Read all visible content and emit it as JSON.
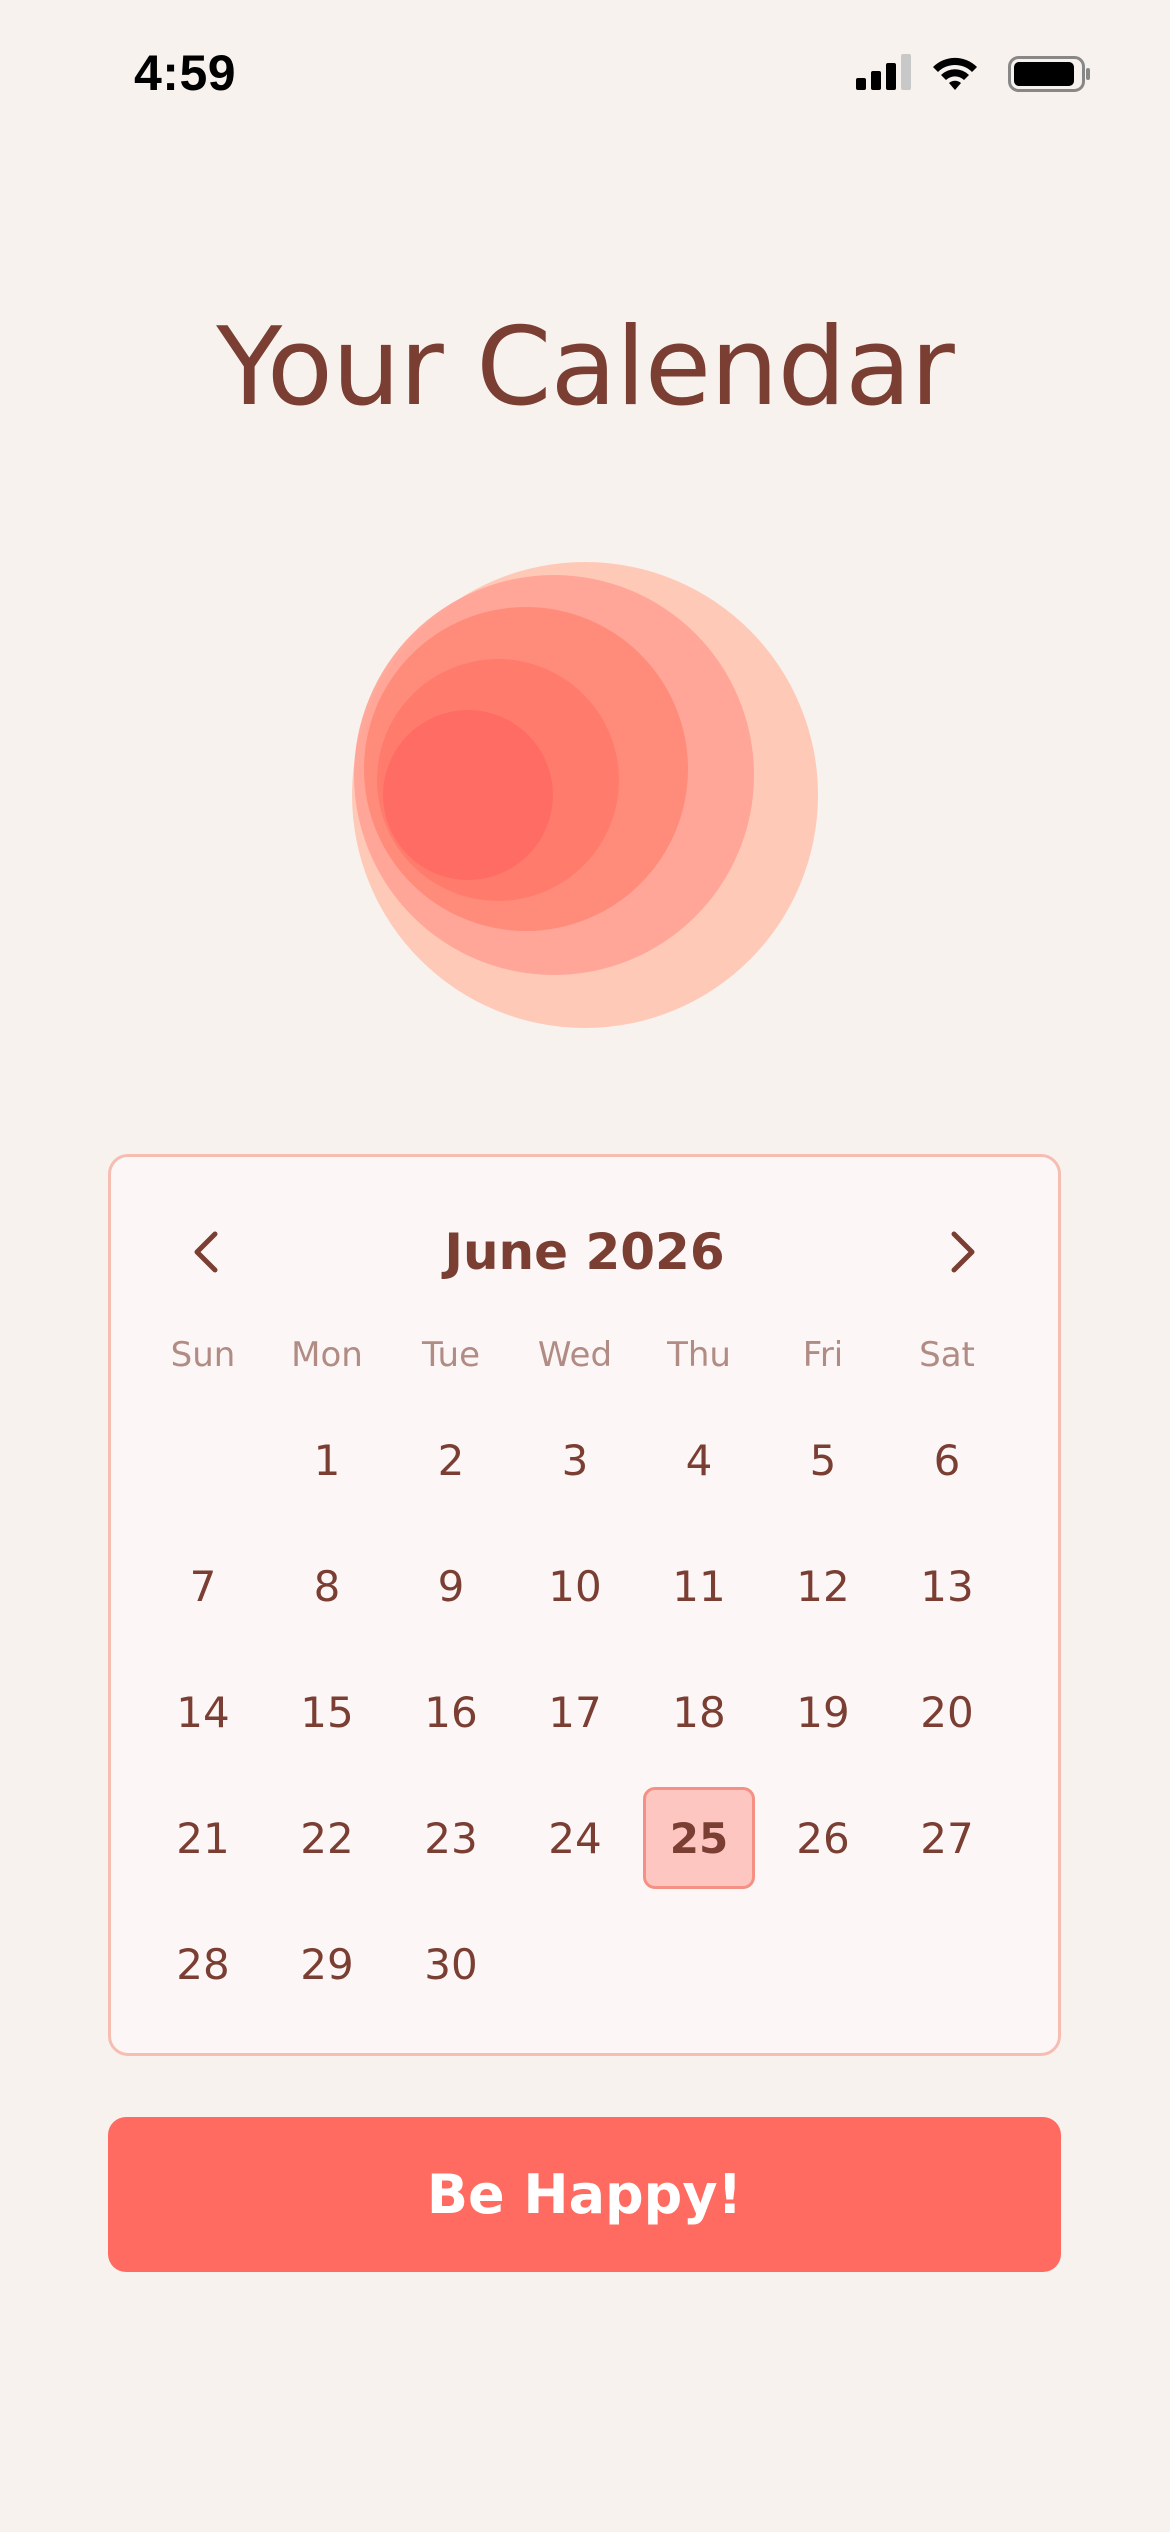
{
  "status_bar": {
    "time": "4:59"
  },
  "title": "Your Calendar",
  "colors": {
    "background": "#f8f2ee",
    "accent": "#ff6b60",
    "text": "#7a3e33",
    "selected_fill": "#fdc6c0",
    "selected_border": "#f49184",
    "card_border": "#f6bdb2",
    "weekday_text": "#b08c84"
  },
  "calendar": {
    "month_label": "June 2026",
    "prev_icon": "chevron-left-icon",
    "next_icon": "chevron-right-icon",
    "weekdays": [
      "Sun",
      "Mon",
      "Tue",
      "Wed",
      "Thu",
      "Fri",
      "Sat"
    ],
    "leading_blanks": 1,
    "days_in_month": 30,
    "selected_day": 25
  },
  "cta": {
    "label": "Be Happy!"
  }
}
